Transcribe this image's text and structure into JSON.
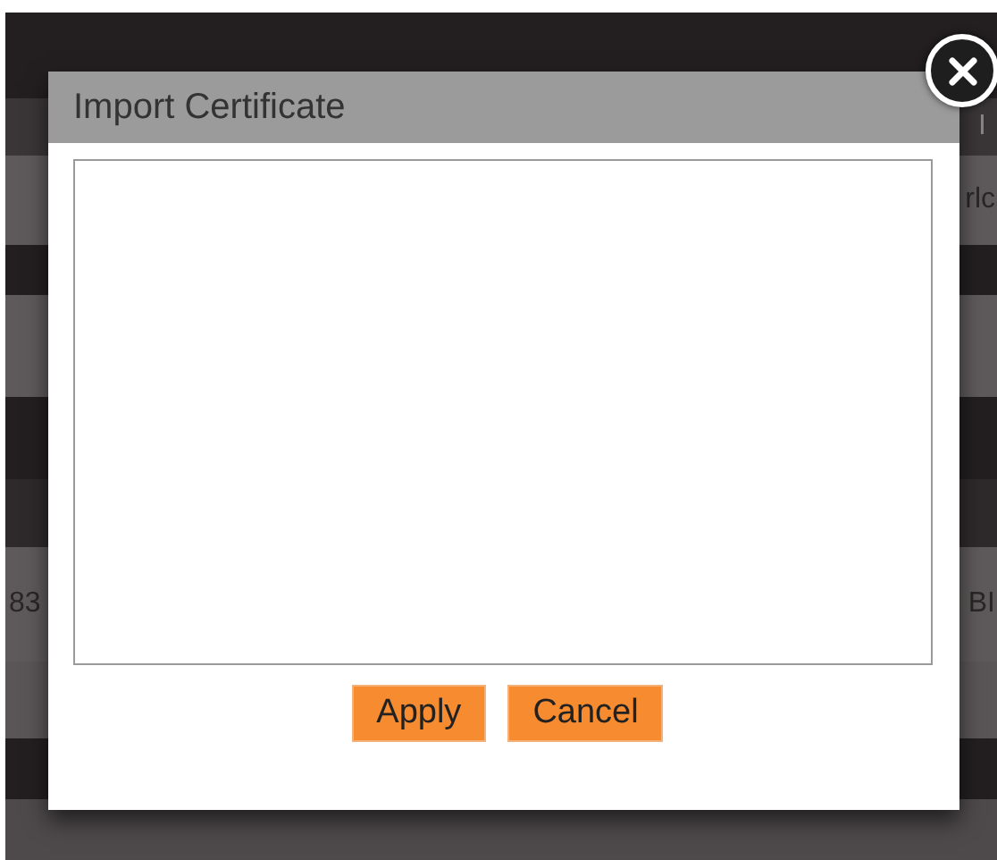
{
  "background_table": {
    "header_fragment": "I",
    "row_1_fragment": "rlc",
    "row_2_left_fragment": "83",
    "row_2_right_fragment": "BI"
  },
  "dialog": {
    "title": "Import Certificate",
    "buttons": [
      {
        "label": "Apply"
      },
      {
        "label": "Cancel"
      }
    ]
  }
}
